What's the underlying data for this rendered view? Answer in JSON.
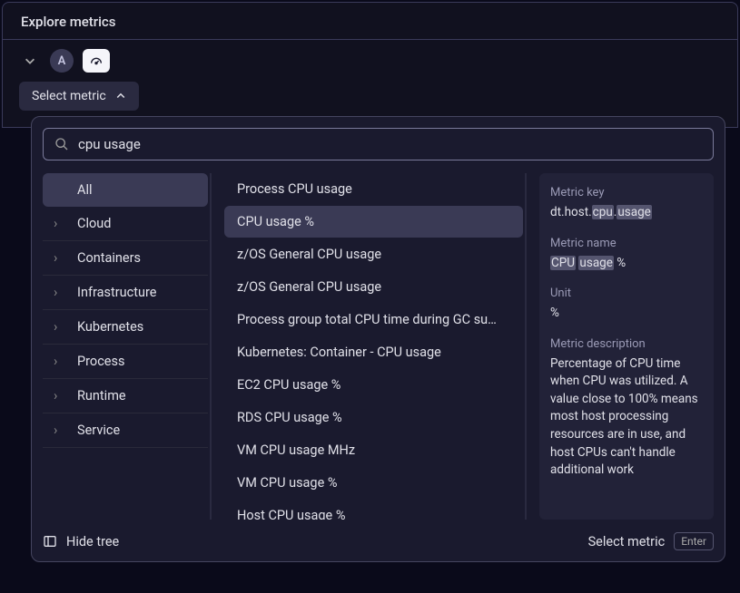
{
  "header": {
    "title": "Explore metrics"
  },
  "query_bar": {
    "badge": "A"
  },
  "select_metric_button": {
    "label": "Select metric"
  },
  "dropdown": {
    "search": {
      "value": "cpu usage"
    },
    "tree": {
      "items": [
        {
          "label": "All",
          "selected": true
        },
        {
          "label": "Cloud",
          "selected": false
        },
        {
          "label": "Containers",
          "selected": false
        },
        {
          "label": "Infrastructure",
          "selected": false
        },
        {
          "label": "Kubernetes",
          "selected": false
        },
        {
          "label": "Process",
          "selected": false
        },
        {
          "label": "Runtime",
          "selected": false
        },
        {
          "label": "Service",
          "selected": false
        }
      ]
    },
    "results": [
      {
        "label": "Process CPU usage",
        "highlighted": false
      },
      {
        "label": "CPU usage %",
        "highlighted": true
      },
      {
        "label": "z/OS General CPU usage",
        "highlighted": false
      },
      {
        "label": "z/OS General CPU usage",
        "highlighted": false
      },
      {
        "label": "Process group total CPU time during GC su…",
        "highlighted": false
      },
      {
        "label": "Kubernetes: Container - CPU usage",
        "highlighted": false
      },
      {
        "label": "EC2 CPU usage %",
        "highlighted": false
      },
      {
        "label": "RDS CPU usage %",
        "highlighted": false
      },
      {
        "label": "VM CPU usage MHz",
        "highlighted": false
      },
      {
        "label": "VM CPU usage %",
        "highlighted": false
      },
      {
        "label": "Host CPU usage %",
        "highlighted": false
      }
    ],
    "details": {
      "labels": {
        "key": "Metric key",
        "name": "Metric name",
        "unit": "Unit",
        "desc": "Metric description"
      },
      "key_parts": {
        "prefix": "dt.host.",
        "hl1": "cpu",
        "sep": ".",
        "hl2": "usage"
      },
      "name_parts": {
        "hl1": "CPU",
        "sp1": " ",
        "hl2": "usage",
        "suffix": " %"
      },
      "unit": "%",
      "description": "Percentage of CPU time when CPU was utilized. A value close to 100% means most host processing resources are in use, and host CPUs can't handle additional work"
    },
    "footer": {
      "hide_tree": "Hide tree",
      "select_metric": "Select metric",
      "enter_key": "Enter"
    }
  }
}
